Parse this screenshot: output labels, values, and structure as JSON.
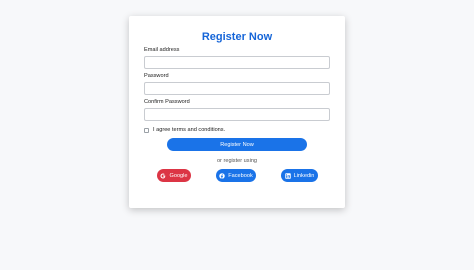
{
  "form": {
    "title": "Register Now",
    "email_label": "Email address",
    "password_label": "Password",
    "confirm_label": "Confirm Password",
    "terms_label": "I agree terms and conditions.",
    "register_label": "Register Now",
    "or_text": "or register using"
  },
  "social": {
    "google": "Google",
    "facebook": "Facebook",
    "linkedin": "Linkedin"
  },
  "colors": {
    "accent": "#1a73e8",
    "title": "#1565d8",
    "google": "#dc3545"
  },
  "icons": {
    "google": "google-icon",
    "facebook": "facebook-icon",
    "linkedin": "linkedin-icon"
  }
}
